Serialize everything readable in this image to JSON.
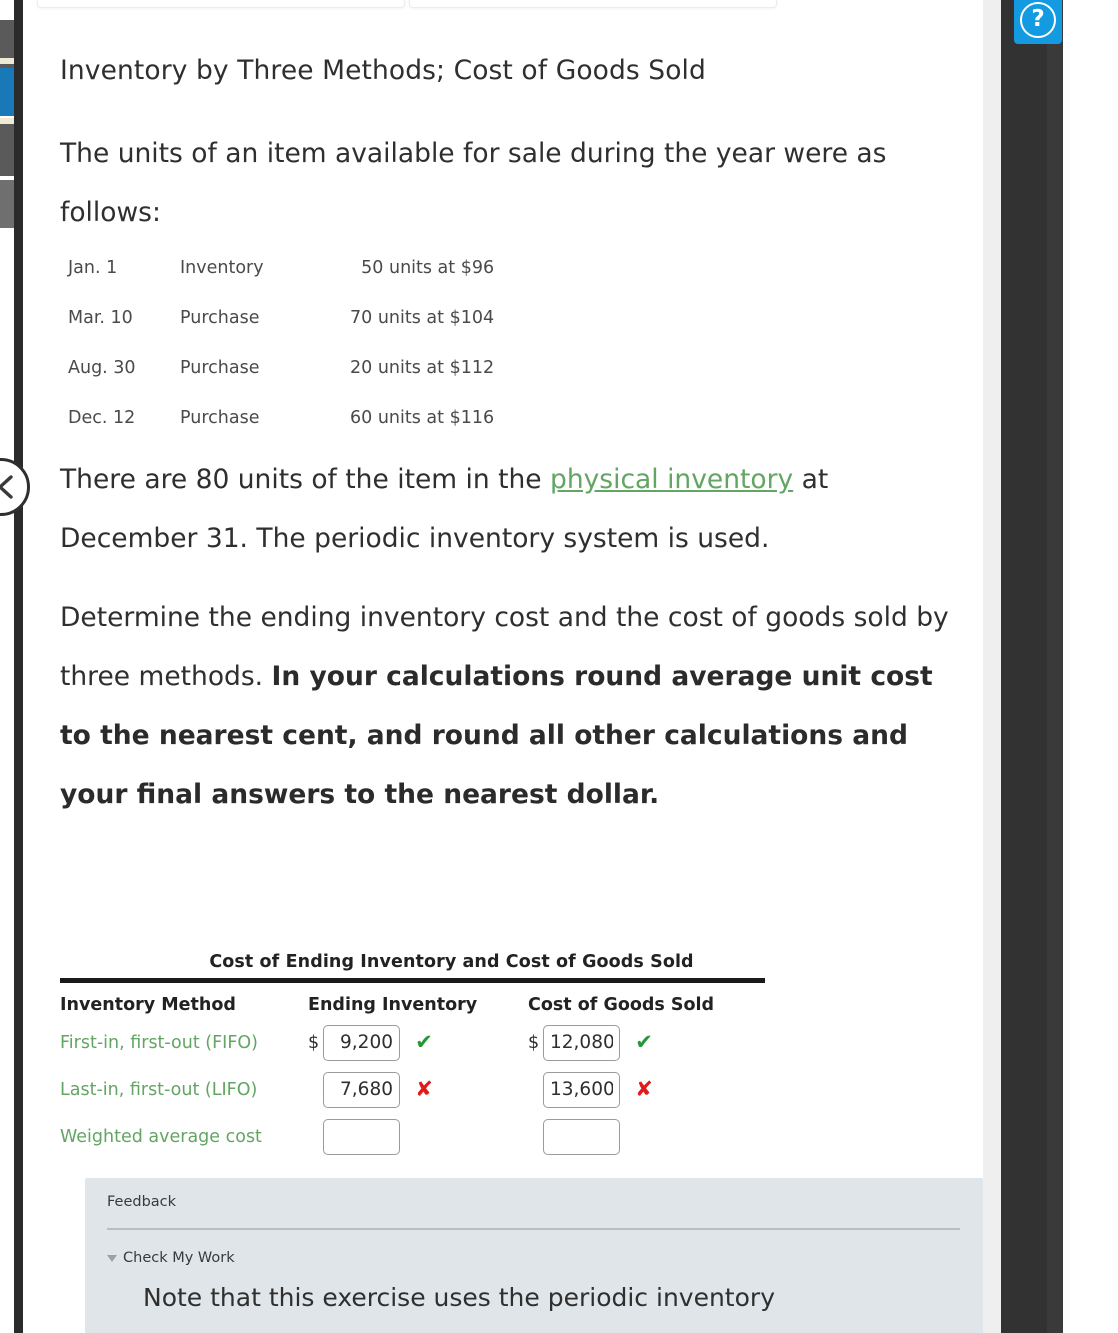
{
  "question": {
    "title": "Inventory by Three Methods; Cost of Goods Sold",
    "intro": "The units of an item available for sale during the year were as follows:",
    "units_table": [
      {
        "date": "Jan. 1",
        "kind": "Inventory",
        "units": "50 units at $96"
      },
      {
        "date": "Mar. 10",
        "kind": "Purchase",
        "units": "70 units at $104"
      },
      {
        "date": "Aug. 30",
        "kind": "Purchase",
        "units": "20 units at $112"
      },
      {
        "date": "Dec. 12",
        "kind": "Purchase",
        "units": "60 units at $116"
      }
    ],
    "physical_before": "There are 80 units of the item in the ",
    "physical_link": "physical inventory",
    "physical_after": " at December 31. The periodic inventory system is used.",
    "determine_normal": "Determine the ending inventory cost and the cost of goods sold by three methods. ",
    "determine_bold": "In your calculations round average unit cost to the nearest cent, and round all other calculations and your final answers to the nearest dollar."
  },
  "answer_table": {
    "title": "Cost of Ending Inventory and Cost of Goods Sold",
    "headers": {
      "method": "Inventory Method",
      "ending_inventory": "Ending Inventory",
      "cost_of_goods_sold": "Cost of Goods Sold"
    },
    "rows": [
      {
        "method": "First-in, first-out (FIFO)",
        "ei_dollar": "$",
        "ei_value": "9,200",
        "ei_mark": "✔",
        "ei_status": "correct",
        "cogs_dollar": "$",
        "cogs_value": "12,080",
        "cogs_mark": "✔",
        "cogs_status": "correct"
      },
      {
        "method": "Last-in, first-out (LIFO)",
        "ei_dollar": "$",
        "ei_value": "7,680",
        "ei_mark": "✘",
        "ei_status": "incorrect",
        "cogs_dollar": "$",
        "cogs_value": "13,600",
        "cogs_mark": "✘",
        "cogs_status": "incorrect"
      },
      {
        "method": "Weighted average cost",
        "ei_dollar": "$",
        "ei_value": "",
        "ei_mark": "",
        "ei_status": "empty",
        "cogs_dollar": "$",
        "cogs_value": "",
        "cogs_mark": "",
        "cogs_status": "empty"
      }
    ]
  },
  "feedback": {
    "label": "Feedback",
    "check_my_work": "Check My Work",
    "note": "Note that this exercise uses the periodic inventory"
  },
  "controls": {
    "help_label": "?",
    "collapse_label": "<"
  },
  "colors": {
    "link_green": "#63a563",
    "correct_green": "#229a33",
    "incorrect_red": "#e11b1b",
    "help_blue": "#139ae0",
    "feedback_bg": "#dfe5e8",
    "rail_dark": "#2b2b2b"
  }
}
